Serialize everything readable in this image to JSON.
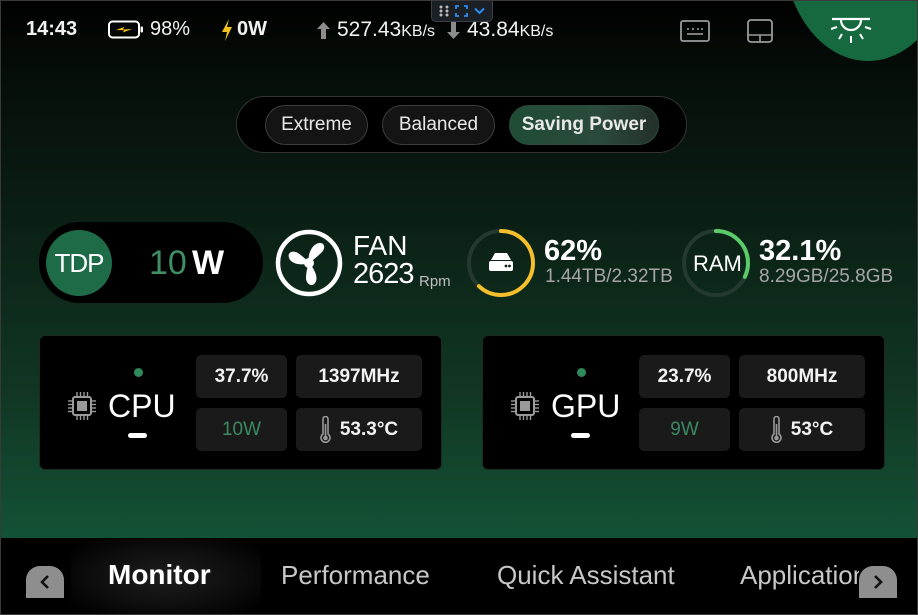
{
  "status_bar": {
    "time": "14:43",
    "battery_icon": "battery-charging-icon",
    "battery_percent": "98%",
    "power_icon": "lightning-bolt-icon",
    "power_draw": "0W",
    "upload_icon": "arrow-up-icon",
    "upload_value": "527.43",
    "upload_unit": "KB/s",
    "download_icon": "arrow-down-icon",
    "download_value": "43.84",
    "download_unit": "KB/s",
    "keyboard_icon": "keyboard-icon",
    "touchpad_icon": "touchpad-icon",
    "light_icon": "ceiling-light-icon"
  },
  "floating_toolbar": {
    "grip_icon": "drag-grip-icon",
    "fullscreen_icon": "fullscreen-icon",
    "expand_icon": "chevron-down-icon"
  },
  "power_modes": {
    "options": [
      "Extreme",
      "Balanced",
      "Saving Power"
    ],
    "selected": "Saving Power"
  },
  "metrics": {
    "tdp": {
      "label": "TDP",
      "value": "10",
      "unit": "W"
    },
    "fan": {
      "label": "FAN",
      "value": "2623",
      "unit": "Rpm",
      "icon": "fan-icon"
    },
    "disk": {
      "icon": "hard-drive-icon",
      "percent": "62%",
      "usage_fraction": 0.62,
      "detail": "1.44TB/2.32TB",
      "ring_color": "#f5c02b"
    },
    "ram": {
      "label": "RAM",
      "percent": "32.1%",
      "usage_fraction": 0.321,
      "detail": "8.29GB/25.8GB",
      "ring_color": "#5ccb6a"
    }
  },
  "cpu": {
    "name": "CPU",
    "icon": "cpu-chip-icon",
    "usage": "37.7%",
    "clock": "1397MHz",
    "power": "10W",
    "temperature": "53.3°C",
    "temp_icon": "thermometer-icon"
  },
  "gpu": {
    "name": "GPU",
    "icon": "gpu-chip-icon",
    "usage": "23.7%",
    "clock": "800MHz",
    "power": "9W",
    "temperature": "53°C",
    "temp_icon": "thermometer-icon"
  },
  "nav": {
    "prev_icon": "chevron-left-icon",
    "next_icon": "chevron-right-icon",
    "tabs": [
      "Monitor",
      "Performance",
      "Quick Assistant",
      "Applications"
    ],
    "active": "Monitor"
  },
  "colors": {
    "accent_green": "#1e6b48",
    "tdp_value_green": "#3f8f66",
    "disk_ring": "#f5c02b",
    "ram_ring": "#5ccb6a",
    "battery_bolt": "#f3c11c"
  }
}
